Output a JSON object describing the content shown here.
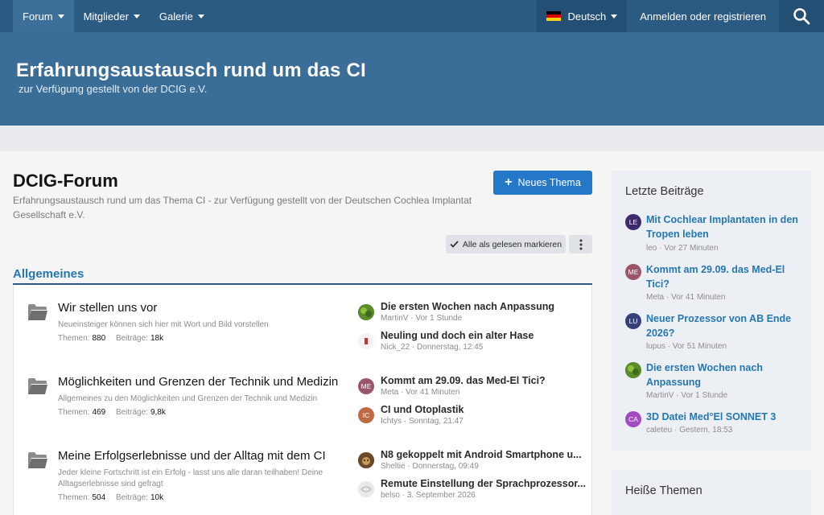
{
  "nav": {
    "tabs": [
      {
        "label": "Forum"
      },
      {
        "label": "Mitglieder"
      },
      {
        "label": "Galerie"
      }
    ],
    "language": "Deutsch",
    "login": "Anmelden oder registrieren"
  },
  "banner": {
    "title": "Erfahrungsaustausch rund um das CI",
    "subtitle": "zur Verfügung gestellt von der DCIG e.V."
  },
  "main": {
    "title": "DCIG-Forum",
    "description": "Erfahrungsaustausch rund um das Thema CI - zur Verfügung gestellt von der Deutschen Cochlea Implantat Gesellschaft e.V.",
    "new_thread": "Neues Thema",
    "mark_read": "Alle als gelesen markieren",
    "category": "Allgemeines",
    "labels": {
      "threads": "Themen:",
      "posts": "Beiträge:"
    },
    "forums": [
      {
        "title": "Wir stellen uns vor",
        "description": "Neueinsteiger können sich hier mit Wort und Bild vorstellen",
        "threads": "880",
        "posts": "18k",
        "latest": [
          {
            "title": "Die ersten Wochen nach Anpassung",
            "author": "MartinV",
            "time": "Vor 1 Stunde",
            "avatar": "",
            "color": "#5a8a2a"
          },
          {
            "title": "Neuling und doch ein alter Hase",
            "author": "Nick_22",
            "time": "Donnerstag, 12:45",
            "avatar": "",
            "color": "#f3f3f3"
          }
        ]
      },
      {
        "title": "Möglichkeiten und Grenzen der Technik und Medizin",
        "description": "Allgemeines zu den Möglichkeiten und Grenzen der Technik und Medizin",
        "threads": "469",
        "posts": "9,8k",
        "latest": [
          {
            "title": "Kommt am 29.09. das Med-El Tici?",
            "author": "Meta",
            "time": "Vor 41 Minuten",
            "avatar": "ME",
            "color": "#9b5568"
          },
          {
            "title": "CI und Otoplastik",
            "author": "Ichtys",
            "time": "Sonntag, 21:47",
            "avatar": "IC",
            "color": "#c06a45"
          }
        ]
      },
      {
        "title": "Meine Erfolgserlebnisse und der Alltag mit dem CI",
        "description": "Jeder kleine Fortschritt ist ein Erfolg - lasst uns alle daran teilhaben! Deine Alltagserlebnisse sind gefragt",
        "threads": "504",
        "posts": "10k",
        "latest": [
          {
            "title": "N8 gekoppelt mit Android Smartphone u...",
            "author": "Sheltie",
            "time": "Donnerstag, 09:49",
            "avatar": "",
            "color": "#7a5a3a"
          },
          {
            "title": "Remute Einstellung der Sprachprozessor...",
            "author": "belso",
            "time": "3. September 2026",
            "avatar": "",
            "color": "#e5e5e5"
          }
        ]
      }
    ]
  },
  "sidebar": {
    "recent_title": "Letzte Beiträge",
    "recent": [
      {
        "title": "Mit Cochlear Implantaten in den Tropen leben",
        "author": "leo",
        "time": "Vor 27 Minuten",
        "avatar": "LE",
        "color": "#3d2a6b"
      },
      {
        "title": "Kommt am 29.09. das Med-El Tici?",
        "author": "Meta",
        "time": "Vor 41 Minuten",
        "avatar": "ME",
        "color": "#9b5568"
      },
      {
        "title": "Neuer Prozessor von AB Ende 2026?",
        "author": "lupus",
        "time": "Vor 51 Minuten",
        "avatar": "LU",
        "color": "#35407a"
      },
      {
        "title": "Die ersten Wochen nach Anpassung",
        "author": "MartinV",
        "time": "Vor 1 Stunde",
        "avatar": "",
        "color": "#5a8a2a"
      },
      {
        "title": "3D Datei Med°El SONNET 3",
        "author": "caleteu",
        "time": "Gestern, 18:53",
        "avatar": "CA",
        "color": "#a24bbf"
      }
    ],
    "hot_title": "Heiße Themen"
  }
}
